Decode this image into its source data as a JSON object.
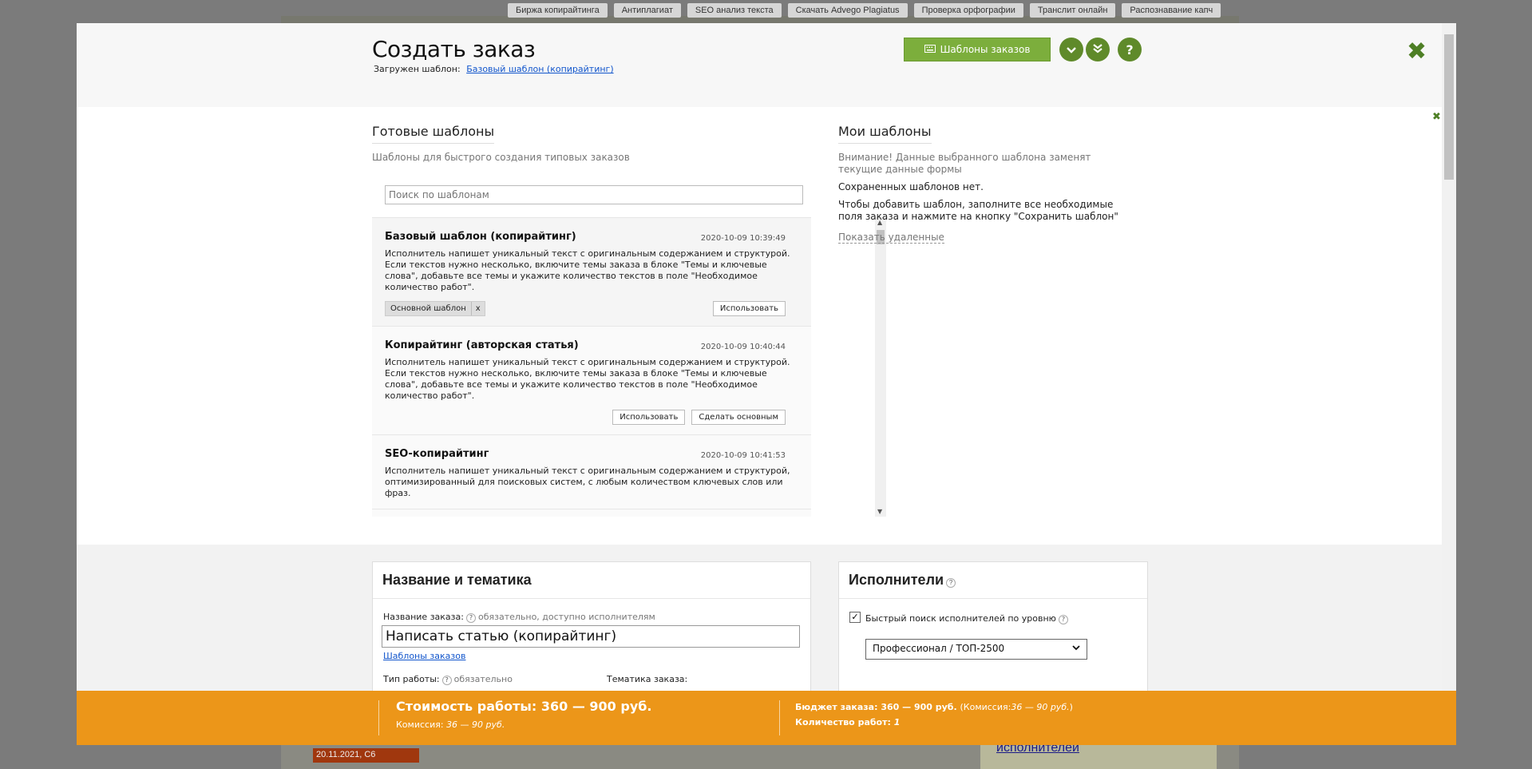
{
  "background": {
    "nav": [
      "Биржа копирайтинга",
      "Антиплагиат",
      "SEO анализ текста",
      "Скачать Advego Plagiatus",
      "Проверка орфографии",
      "Транслит онлайн",
      "Распознавание капч"
    ],
    "side_date": "20.11.2021, С6",
    "right_link": "исполнителей"
  },
  "modal": {
    "title": "Создать заказ",
    "loaded_label": "Загружен шаблон:",
    "loaded_template": "Базовый шаблон (копирайтинг)",
    "templates_button": "Шаблоны заказов",
    "close_label": "✖"
  },
  "ready": {
    "title": "Готовые шаблоны",
    "subtitle": "Шаблоны для быстрого создания типовых заказов",
    "search_placeholder": "Поиск по шаблонам",
    "items": [
      {
        "title": "Базовый шаблон (копирайтинг)",
        "date": "2020-10-09 10:39:49",
        "desc": "Исполнитель напишет уникальный текст с оригинальным содержанием и структурой. Если текстов нужно несколько, включите темы заказа в блоке \"Темы и ключевые слова\", добавьте все темы и укажите количество текстов в поле \"Необходимое количество работ\".",
        "tag": "Основной шаблон",
        "tag_x": "x",
        "use": "Использовать"
      },
      {
        "title": "Копирайтинг (авторская статья)",
        "date": "2020-10-09 10:40:44",
        "desc": "Исполнитель напишет уникальный текст с оригинальным содержанием и структурой. Если текстов нужно несколько, включите темы заказа в блоке \"Темы и ключевые слова\", добавьте все темы и укажите количество текстов в поле \"Необходимое количество работ\".",
        "use": "Использовать",
        "make_main": "Сделать основным"
      },
      {
        "title": "SEO-копирайтинг",
        "date": "2020-10-09 10:41:53",
        "desc": "Исполнитель напишет уникальный текст с оригинальным содержанием и структурой, оптимизированный для поисковых систем, с любым количеством ключевых слов или фраз."
      }
    ]
  },
  "mine": {
    "title": "Мои шаблоны",
    "warning": "Внимание! Данные выбранного шаблона заменят текущие данные формы",
    "none": "Сохраненных шаблонов нет.",
    "hint": "Чтобы добавить шаблон, заполните все необходимые поля заказа и нажмите на кнопку \"Сохранить шаблон\"",
    "show_deleted": "Показать удаленные"
  },
  "form": {
    "name_card_title": "Название и тематика",
    "name_label": "Название заказа:",
    "name_note": "обязательно, доступно исполнителям",
    "name_value": "Написать статью (копирайтинг)",
    "templates_link": "Шаблоны заказов",
    "work_type_label": "Тип работы:",
    "work_type_note": "обязательно",
    "topic_label": "Тематика заказа:",
    "performers_title": "Исполнители",
    "quick_search": "Быстрый поиск исполнителей по уровню",
    "level_value": "Профессионал / ТОП-2500"
  },
  "footer": {
    "cost": "Стоимость работы: 360 — 900 руб.",
    "commission_label": "Комиссия:",
    "commission_value": "36 — 90 руб.",
    "budget": "Бюджет заказа: 360 — 900 руб.",
    "budget_commission_label": "(Комиссия:",
    "budget_commission_value": "36 — 90 руб.",
    "budget_commission_end": ")",
    "count_label": "Количество работ:",
    "count_value": "1"
  },
  "colors": {
    "accent_green": "#7cae3c",
    "footer_orange": "#ec9619"
  }
}
